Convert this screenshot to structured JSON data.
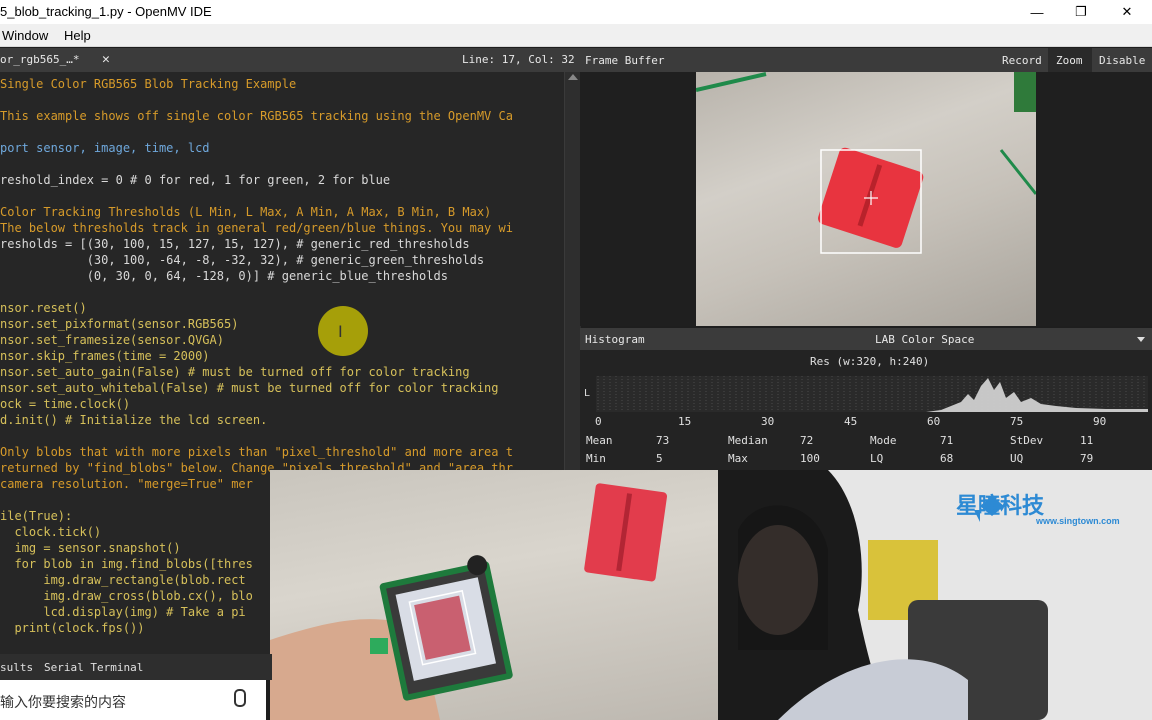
{
  "window": {
    "title": "5_blob_tracking_1.py - OpenMV IDE",
    "minimize_glyph": "—",
    "maximize_glyph": "❐",
    "close_glyph": "✕"
  },
  "menu": {
    "items": [
      "Window",
      "Help"
    ]
  },
  "editor": {
    "tab_label": "or_rgb565_…*",
    "close_glyph": "✕",
    "cursor_pos": "Line: 17, Col: 32",
    "lines": [
      {
        "t": "Single Color RGB565 Blob Tracking Example",
        "c": "c-com"
      },
      {
        "t": "",
        "c": "c-txt"
      },
      {
        "t": "This example shows off single color RGB565 tracking using the OpenMV Ca",
        "c": "c-com"
      },
      {
        "t": "",
        "c": "c-txt"
      },
      {
        "t": "port sensor, image, time, lcd",
        "c": "c-id"
      },
      {
        "t": "",
        "c": "c-txt"
      },
      {
        "t": "reshold_index = 0 # 0 for red, 1 for green, 2 for blue",
        "c": "c-txt"
      },
      {
        "t": "",
        "c": "c-txt"
      },
      {
        "t": "Color Tracking Thresholds (L Min, L Max, A Min, A Max, B Min, B Max)",
        "c": "c-com"
      },
      {
        "t": "The below thresholds track in general red/green/blue things. You may wi",
        "c": "c-com"
      },
      {
        "t": "resholds = [(30, 100, 15, 127, 15, 127), # generic_red_thresholds",
        "c": "c-txt"
      },
      {
        "t": "            (30, 100, -64, -8, -32, 32), # generic_green_thresholds",
        "c": "c-txt"
      },
      {
        "t": "            (0, 30, 0, 64, -128, 0)] # generic_blue_thresholds",
        "c": "c-txt"
      },
      {
        "t": "",
        "c": "c-txt"
      },
      {
        "t": "nsor.reset()",
        "c": "c-kw"
      },
      {
        "t": "nsor.set_pixformat(sensor.RGB565)",
        "c": "c-kw"
      },
      {
        "t": "nsor.set_framesize(sensor.QVGA)",
        "c": "c-kw"
      },
      {
        "t": "nsor.skip_frames(time = 2000)",
        "c": "c-kw"
      },
      {
        "t": "nsor.set_auto_gain(False) # must be turned off for color tracking",
        "c": "c-kw"
      },
      {
        "t": "nsor.set_auto_whitebal(False) # must be turned off for color tracking",
        "c": "c-kw"
      },
      {
        "t": "ock = time.clock()",
        "c": "c-kw"
      },
      {
        "t": "d.init() # Initialize the lcd screen.",
        "c": "c-kw"
      },
      {
        "t": "",
        "c": "c-txt"
      },
      {
        "t": "Only blobs that with more pixels than \"pixel_threshold\" and more area t",
        "c": "c-com"
      },
      {
        "t": "returned by \"find_blobs\" below. Change \"pixels_threshold\" and \"area_thr",
        "c": "c-com"
      },
      {
        "t": "camera resolution. \"merge=True\" mer",
        "c": "c-com"
      },
      {
        "t": "",
        "c": "c-txt"
      },
      {
        "t": "ile(True):",
        "c": "c-kw"
      },
      {
        "t": "  clock.tick()",
        "c": "c-kw"
      },
      {
        "t": "  img = sensor.snapshot()",
        "c": "c-kw"
      },
      {
        "t": "  for blob in img.find_blobs([thres",
        "c": "c-kw"
      },
      {
        "t": "      img.draw_rectangle(blob.rect",
        "c": "c-kw"
      },
      {
        "t": "      img.draw_cross(blob.cx(), blo",
        "c": "c-kw"
      },
      {
        "t": "      lcd.display(img) # Take a pi",
        "c": "c-kw"
      },
      {
        "t": "  print(clock.fps())",
        "c": "c-kw"
      }
    ]
  },
  "framebuffer": {
    "title": "Frame Buffer",
    "record": "Record",
    "zoom": "Zoom",
    "disable": "Disable"
  },
  "histogram": {
    "title": "Histogram",
    "colorspace": "LAB Color Space",
    "resolution": "Res (w:320, h:240)",
    "axis_label": "L",
    "ticks": [
      "0",
      "15",
      "30",
      "45",
      "60",
      "75",
      "90"
    ],
    "stats_row1": [
      {
        "k": "Mean",
        "v": "73"
      },
      {
        "k": "Median",
        "v": "72"
      },
      {
        "k": "Mode",
        "v": "71"
      },
      {
        "k": "StDev",
        "v": "11"
      }
    ],
    "stats_row2": [
      {
        "k": "Min",
        "v": "5"
      },
      {
        "k": "Max",
        "v": "100"
      },
      {
        "k": "LQ",
        "v": "68"
      },
      {
        "k": "UQ",
        "v": "79"
      }
    ]
  },
  "bottom_tabs": {
    "results": "sults",
    "serial": "Serial Terminal"
  },
  "taskbar": {
    "search_placeholder": "输入你要搜索的内容",
    "mic_glyph": "🎙"
  },
  "watermark": {
    "brand": "星瞳科技",
    "url": "www.singtown.com"
  },
  "cursor_glyph": "I"
}
